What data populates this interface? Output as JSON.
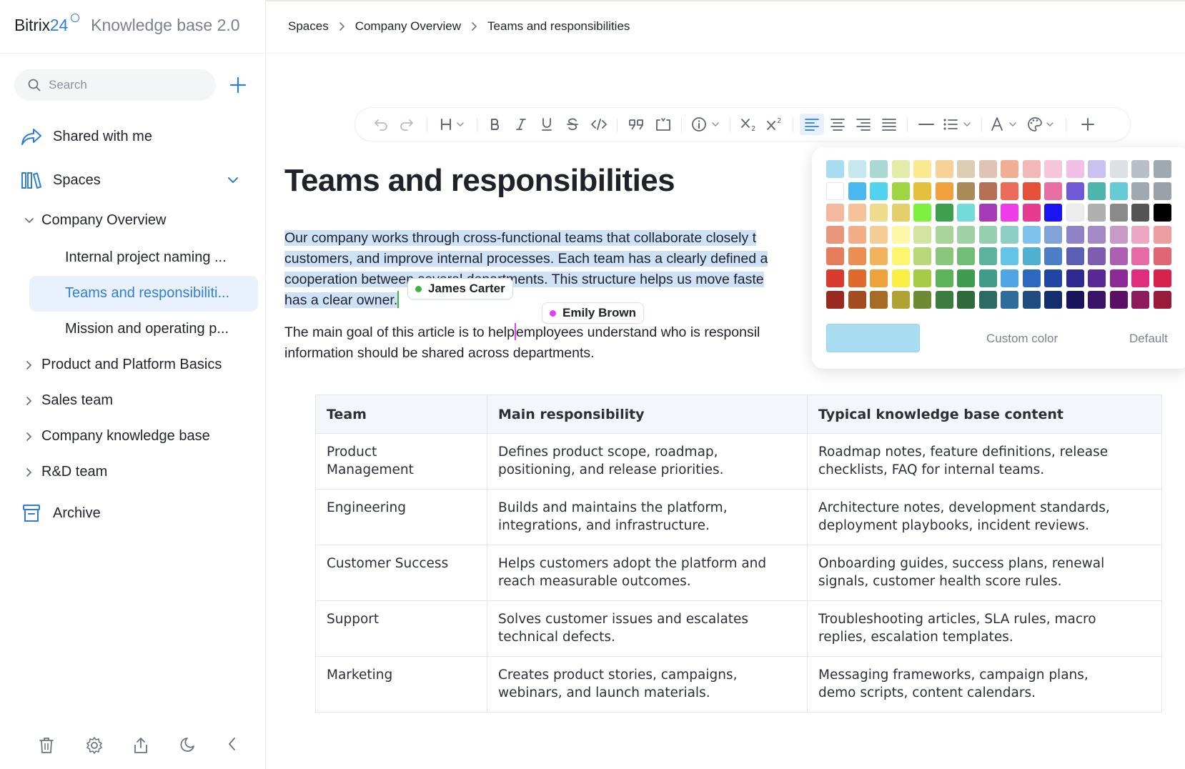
{
  "brand": {
    "name": "Bitrix",
    "name_accent": "24",
    "product": "Knowledge base 2.0"
  },
  "search": {
    "placeholder": "Search"
  },
  "nav": {
    "shared": "Shared with me",
    "spaces": "Spaces",
    "archive": "Archive"
  },
  "tree": {
    "company_overview": "Company Overview",
    "children": [
      "Internal project naming ...",
      "Teams and responsibiliti...",
      "Mission and operating p..."
    ],
    "product_platform": "Product and Platform Basics",
    "sales": "Sales team",
    "company_kb": "Company knowledge base",
    "rnd": "R&D team"
  },
  "breadcrumb": [
    "Spaces",
    "Company Overview",
    "Teams and responsibilities"
  ],
  "toolbar": {
    "icons": [
      "undo-icon",
      "redo-icon",
      "heading-icon",
      "bold-icon",
      "italic-icon",
      "underline-icon",
      "strikethrough-icon",
      "code-icon",
      "quote-icon",
      "block-icon",
      "info-icon",
      "subscript-icon",
      "superscript-icon",
      "align-left-icon",
      "align-center-icon",
      "align-right-icon",
      "align-justify-icon",
      "divider-icon",
      "list-icon",
      "text-color-icon",
      "highlight-color-icon",
      "insert-icon"
    ]
  },
  "document": {
    "title": "Teams and responsibilities",
    "para1": {
      "line1": "Our company works through cross-functional teams that collaborate closely t",
      "line2": "customers, and improve internal processes. Each team has a clearly defined a",
      "line3": "cooperation between several departments. This structure helps us move faste",
      "line4": "has a clear owner."
    },
    "para2": {
      "line1a": "The main goal of this article is to help",
      "line1b": "employees understand who is responsil",
      "line2": "information should be shared across departments."
    }
  },
  "presence": [
    {
      "name": "James Carter",
      "color": "#3bb54a"
    },
    {
      "name": "Emily Brown",
      "color": "#e040fb"
    }
  ],
  "table": {
    "headers": [
      "Team",
      "Main responsibility",
      "Typical knowledge base content"
    ],
    "rows": [
      [
        "Product\nManagement",
        "Defines product scope, roadmap,\npositioning, and release priorities.",
        "Roadmap notes, feature definitions, release\nchecklists, FAQ for internal teams."
      ],
      [
        "Engineering",
        "Builds and maintains the platform,\nintegrations, and infrastructure.",
        "Architecture notes, development standards,\ndeployment playbooks, incident reviews."
      ],
      [
        "Customer Success",
        "Helps customers adopt the platform and\nreach measurable outcomes.",
        "Onboarding guides, success plans, renewal\nsignals, customer health score rules."
      ],
      [
        "Support",
        "Solves customer issues and escalates\ntechnical defects.",
        "Troubleshooting articles, SLA rules, macro\nreplies, escalation templates."
      ],
      [
        "Marketing",
        "Creates product stories, campaigns,\nwebinars, and launch materials.",
        "Messaging frameworks, campaign plans,\ndemo scripts, content calendars."
      ]
    ]
  },
  "color_picker": {
    "custom_label": "Custom color",
    "default_label": "Default",
    "selected": "#a8dcf0",
    "swatches": [
      [
        "#a8dcf0",
        "#c5e7ee",
        "#a9d9d2",
        "#e2eca8",
        "#fbe88f",
        "#f8d199",
        "#dccdb2",
        "#e0c2b6",
        "#f0ae95",
        "#f3b8b8",
        "#f7c5d8",
        "#f0c0e8",
        "#c9c2f0",
        "#dde0e4",
        "#b8bfc7",
        "#a0a8b1"
      ],
      [
        "#ffffff",
        "#4ab7f0",
        "#52d3ef",
        "#9fd442",
        "#e4c13d",
        "#f0a13b",
        "#a98a58",
        "#b46f55",
        "#ec6a5a",
        "#e55039",
        "#e86fa6",
        "#7059d6",
        "#4db5ac",
        "#67cbd6",
        "#a0a8b1",
        "#9aa1aa"
      ],
      [
        "#f4b79f",
        "#f6c29a",
        "#efdc8b",
        "#e3d06d",
        "#7cf03e",
        "#3ea04f",
        "#74dcd8",
        "#a63ab8",
        "#ef3cea",
        "#e73b8f",
        "#1a14f5",
        "#ececec",
        "#b0b0b0",
        "#8a8a8a",
        "#555555",
        "#000000"
      ],
      [
        "#e9977c",
        "#f2ae88",
        "#f6cc96",
        "#fdf7a7",
        "#d3e3a2",
        "#a8d39a",
        "#a0d0a5",
        "#96cfb0",
        "#8fcec4",
        "#7fc3ed",
        "#80a3d8",
        "#8f82c7",
        "#a48ac4",
        "#c89ac8",
        "#eda6c4",
        "#ed9ea0"
      ],
      [
        "#e37d5b",
        "#ec8d54",
        "#f2b35d",
        "#fcf56d",
        "#b9d87a",
        "#8ac77d",
        "#73be76",
        "#5cb29a",
        "#64c4e8",
        "#50b0cf",
        "#4d7fc7",
        "#5a5fb4",
        "#7e5db0",
        "#ad5fb1",
        "#e56aa6",
        "#e06673"
      ],
      [
        "#d93a2f",
        "#e06a2e",
        "#eda23b",
        "#fbee45",
        "#a5cb47",
        "#5eb35a",
        "#3f9b4d",
        "#3f9c89",
        "#4fa5e8",
        "#2e67c0",
        "#2145a4",
        "#302a90",
        "#5a2797",
        "#8e2a96",
        "#e02d7e",
        "#d7224c"
      ],
      [
        "#9b2a1e",
        "#a44b1f",
        "#a76b24",
        "#b1a234",
        "#6d8b33",
        "#3c7d3f",
        "#2f6a3a",
        "#2d6a63",
        "#2f6c9c",
        "#1f4c80",
        "#122e6e",
        "#19145c",
        "#3b1469",
        "#5c0f67",
        "#8d1a5a",
        "#9a1a3c"
      ]
    ]
  }
}
